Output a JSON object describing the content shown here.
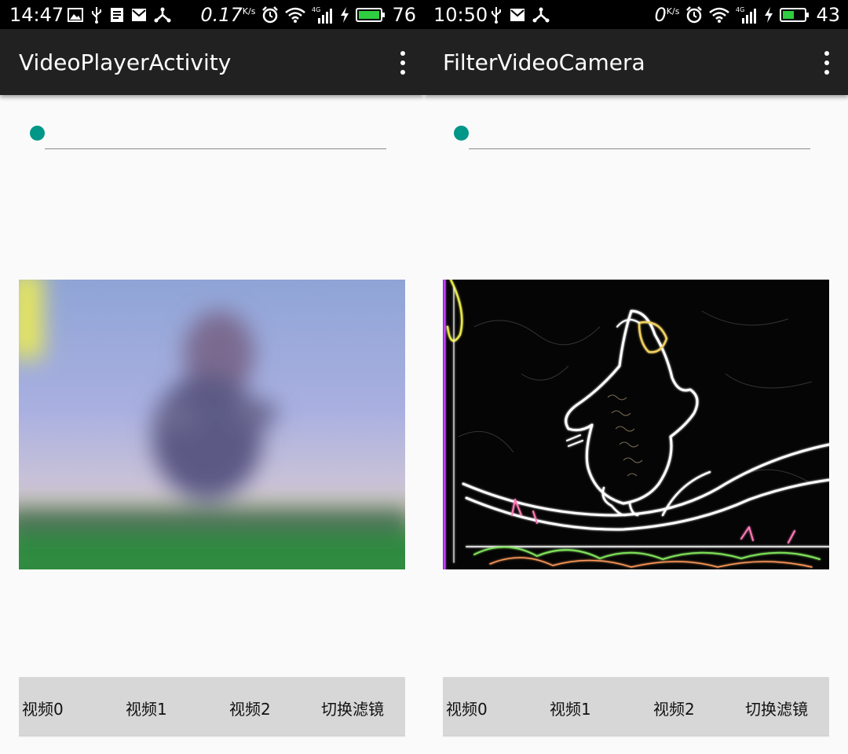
{
  "screens": [
    {
      "status": {
        "time": "14:47",
        "net_speed": "0.17",
        "net_unit": "K/s",
        "network_type": "4G",
        "battery": "76",
        "left_icons": [
          "image-icon",
          "usb-icon",
          "document-icon",
          "mail-icon",
          "share-icon"
        ]
      },
      "title": "VideoPlayerActivity",
      "seek_progress": 0,
      "video_style": "blurred",
      "buttons": [
        "视频0",
        "视频1",
        "视频2",
        "切换滤镜"
      ]
    },
    {
      "status": {
        "time": "10:50",
        "net_speed": "0",
        "net_unit": "K/s",
        "network_type": "4G",
        "battery": "43",
        "left_icons": [
          "usb-icon",
          "mail-icon",
          "share-icon"
        ]
      },
      "title": "FilterVideoCamera",
      "seek_progress": 0,
      "video_style": "edge-detection",
      "buttons": [
        "视频0",
        "视频1",
        "视频2",
        "切换滤镜"
      ]
    }
  ],
  "colors": {
    "status_bar": "#000000",
    "toolbar": "#212121",
    "accent": "#009688",
    "background": "#fafafa",
    "button_bar": "#d6d7d6",
    "battery_fill": "#2ecc40"
  }
}
